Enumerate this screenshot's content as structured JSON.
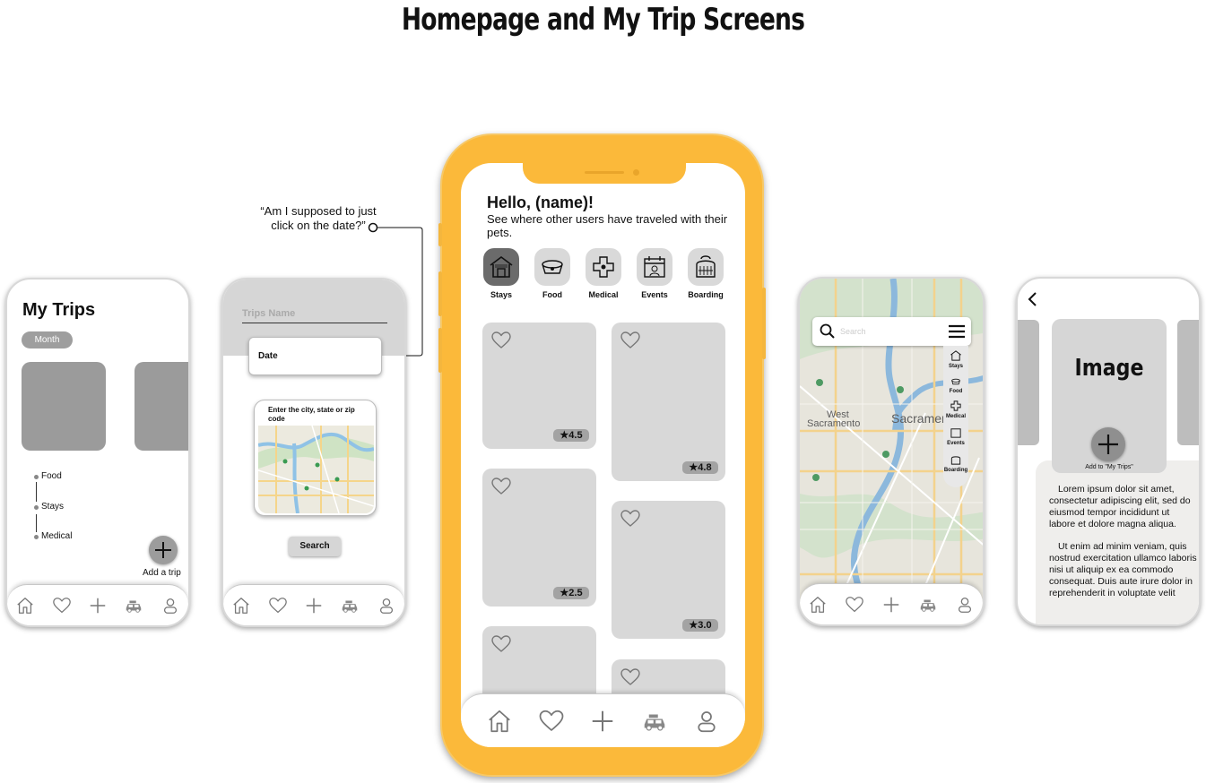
{
  "page": {
    "title": "Homepage and My Trip Screens"
  },
  "annotation": {
    "text": "“Am I supposed to just click on the date?”"
  },
  "my_trips": {
    "title": "My Trips",
    "filter": "Month",
    "timeline": [
      "Food",
      "Stays",
      "Medical"
    ],
    "add_label": "Add a trip"
  },
  "trip_form": {
    "name_placeholder": "Trips Name",
    "date_label": "Date",
    "location_hint": "Enter the city, state or zip code",
    "search_label": "Search"
  },
  "home": {
    "greeting": "Hello, (name)!",
    "subtitle": "See where other users have traveled with their pets.",
    "categories": [
      {
        "label": "Stays",
        "icon": "house-icon",
        "active": true
      },
      {
        "label": "Food",
        "icon": "pet-bowl-icon",
        "active": false
      },
      {
        "label": "Medical",
        "icon": "medical-cross-icon",
        "active": false
      },
      {
        "label": "Events",
        "icon": "calendar-event-icon",
        "active": false
      },
      {
        "label": "Boarding",
        "icon": "pet-carrier-icon",
        "active": false
      }
    ],
    "ratings": [
      "4.5",
      "4.8",
      "2.5",
      "3.0"
    ]
  },
  "map_screen": {
    "search_placeholder": "Search",
    "categories": [
      "Stays",
      "Food",
      "Medical",
      "Events",
      "Boarding"
    ],
    "labels": [
      "West",
      "Sacramento",
      "Sacramento"
    ]
  },
  "detail": {
    "image_label": "Image",
    "add_label": "Add to \"My Trips\"",
    "paragraph_1": "Lorem ipsum dolor sit amet, consectetur adipiscing elit, sed do eiusmod tempor incididunt ut labore et dolore magna aliqua.",
    "paragraph_2": "Ut enim ad minim veniam, quis nostrud exercitation ullamco laboris nisi ut aliquip ex ea commodo consequat. Duis aute irure dolor in reprehenderit in voluptate velit"
  },
  "tabbar": {
    "icons": [
      "home-icon",
      "heart-icon",
      "plus-icon",
      "car-icon",
      "profile-icon"
    ]
  },
  "colors": {
    "accent": "#fbb93a",
    "card": "#d8d8d8",
    "active_category": "#6b6b6b"
  }
}
